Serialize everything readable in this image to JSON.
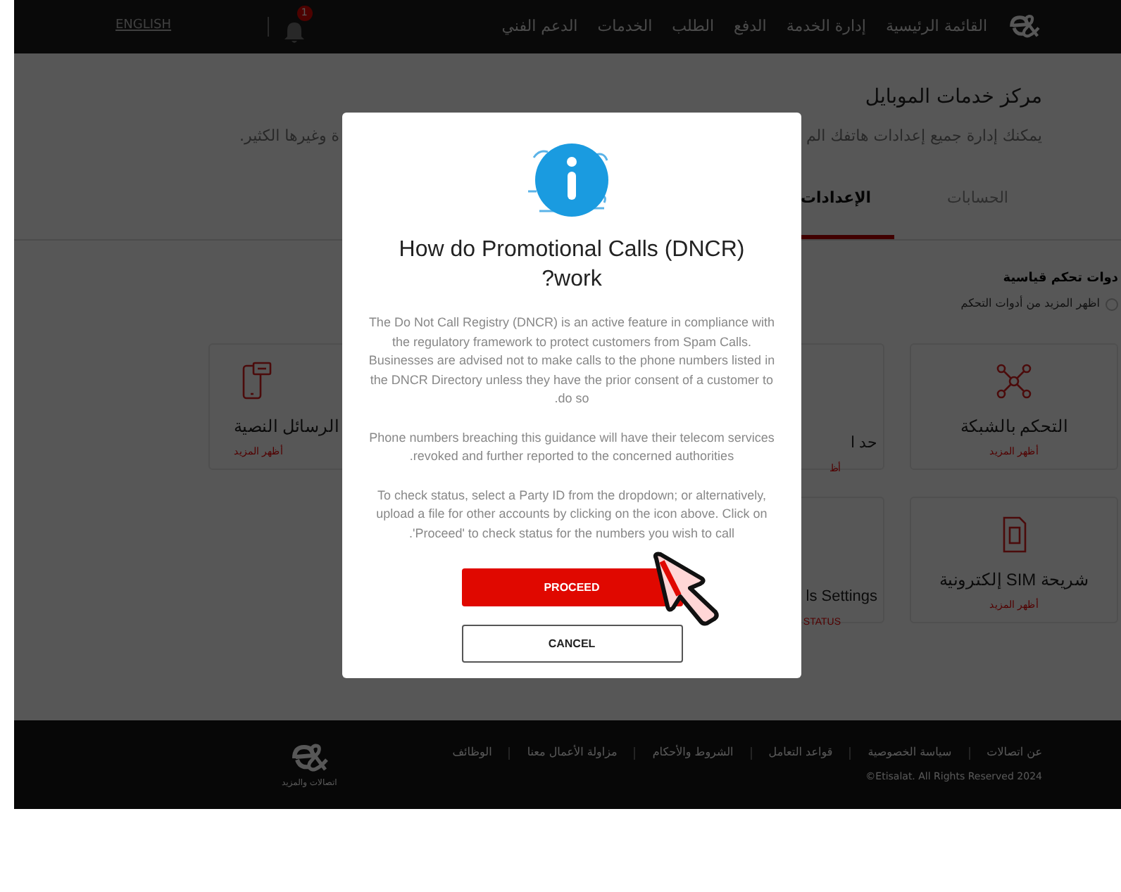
{
  "header": {
    "nav": [
      {
        "label": "القائمة الرئيسية"
      },
      {
        "label": "إدارة الخدمة"
      },
      {
        "label": "الدفع"
      },
      {
        "label": "الطلب"
      },
      {
        "label": "الخدمات"
      },
      {
        "label": "الدعم الفني"
      }
    ],
    "notification_count": "1",
    "language": "ENGLISH"
  },
  "page": {
    "title": "مركز خدمات الموبايل",
    "subtitle_parts": [
      "يمكنك إدارة جميع إعدادات هاتفك الم",
      "ة وغيرها الكثير."
    ]
  },
  "tabs": [
    {
      "label": "الحسابات",
      "selected": false
    },
    {
      "label": "الإعدادات",
      "selected": true
    }
  ],
  "section": {
    "title": "دوات تحكم قياسية",
    "hint": "اظهر المزيد من أدوات التحكم"
  },
  "card_rows": [
    [
      {
        "kind": "full",
        "title": "التحكم بالشبكة",
        "link": "أظهر المزيد"
      },
      {
        "kind": "cut_left",
        "title": "حد ا",
        "link": "أظ"
      },
      {
        "kind": "cut_right",
        "title": "الرسائل النصية",
        "link": "أظهر المزيد"
      }
    ],
    [
      {
        "kind": "full",
        "title": "شريحة SIM إلكترونية",
        "link": "أظهر المزيد"
      },
      {
        "kind": "cut_left",
        "title": "ls Settings",
        "link": "STATUS"
      }
    ]
  ],
  "footer": {
    "logo_caption": "اتصالات والمزيد",
    "links": [
      "عن اتصالات",
      "سياسة الخصوصية",
      "قواعد التعامل",
      "الشروط والأحكام",
      "مزاولة الأعمال معنا",
      "الوظائف"
    ],
    "copyright": "2024 Etisalat. All Rights Reserved©"
  },
  "dialog": {
    "title": "How do Promotional Calls (DNCR) ?work",
    "paragraphs": [
      "The Do Not Call Registry (DNCR) is an active feature in compliance with the regulatory framework to protect customers from Spam Calls. Businesses are advised not to make calls to the phone numbers listed in the DNCR Directory unless they have the prior consent of a customer to .do so",
      "Phone numbers breaching this guidance will have their telecom services .revoked and further reported to the concerned authorities",
      "To check status, select a Party ID from the dropdown; or alternatively, upload a file for other accounts by clicking on the icon above. Click on .'Proceed' to check status for the numbers you wish to call"
    ],
    "buttons": [
      {
        "kind": "primary",
        "label": "PROCEED"
      },
      {
        "kind": "secondary",
        "label": "CANCEL"
      }
    ]
  }
}
